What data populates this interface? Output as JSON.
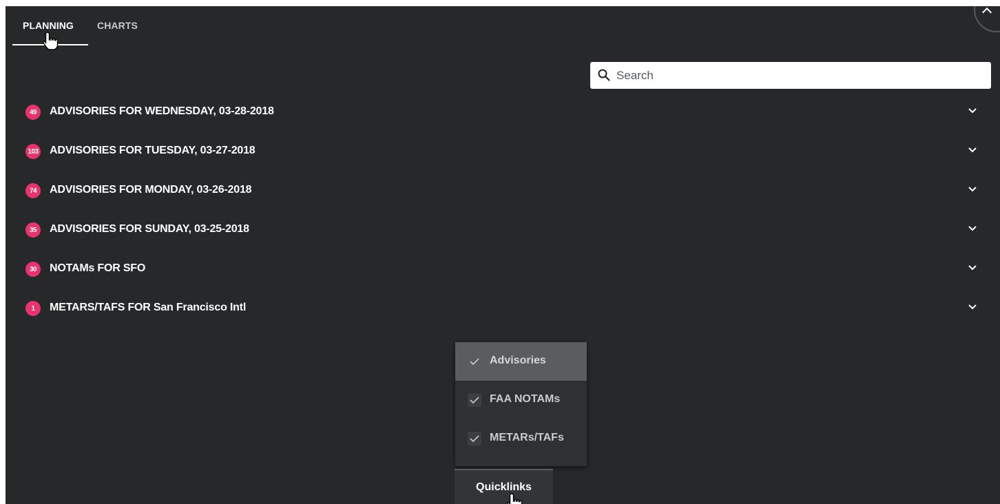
{
  "tabs": {
    "planning": "PLANNING",
    "charts": "CHARTS"
  },
  "search": {
    "placeholder": "Search",
    "value": ""
  },
  "sections": [
    {
      "count": "49",
      "title": "ADVISORIES FOR WEDNESDAY, 03-28-2018"
    },
    {
      "count": "103",
      "title": "ADVISORIES FOR TUESDAY, 03-27-2018"
    },
    {
      "count": "74",
      "title": "ADVISORIES FOR MONDAY, 03-26-2018"
    },
    {
      "count": "35",
      "title": "ADVISORIES FOR SUNDAY, 03-25-2018"
    },
    {
      "count": "30",
      "title": "NOTAMs FOR SFO"
    },
    {
      "count": "1",
      "title": "METARS/TAFS FOR San Francisco Intl"
    }
  ],
  "menu": {
    "items": [
      {
        "label": "Advisories",
        "checked": true,
        "active": true
      },
      {
        "label": "FAA NOTAMs",
        "checked": true,
        "active": false
      },
      {
        "label": "METARs/TAFs",
        "checked": true,
        "active": false
      }
    ],
    "button_label": "Quicklinks"
  },
  "icons": {
    "search": "search-icon",
    "chevron": "chevron-down-icon",
    "check": "check-icon",
    "cursor": "hand-pointer-icon"
  },
  "colors": {
    "background": "#262829",
    "badge": "#e8336f",
    "menu_active": "#5a5c5e"
  }
}
